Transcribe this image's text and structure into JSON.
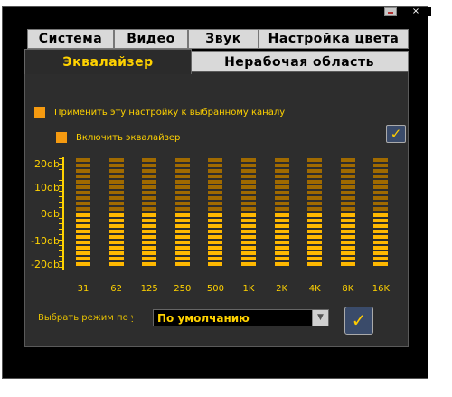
{
  "tabs_row1": [
    {
      "label": "Система"
    },
    {
      "label": "Видео"
    },
    {
      "label": "Звук"
    },
    {
      "label": "Настройка цвета"
    }
  ],
  "tabs_row2": [
    {
      "label": "Эквалайзер",
      "active": true
    },
    {
      "label": "Нерабочая область",
      "active": false
    }
  ],
  "options": {
    "apply_to_channel": "Применить эту настройку к выбранному каналу",
    "enable_equalizer": "Включить эквалайзер"
  },
  "db_labels": [
    "20db",
    "10db",
    "0db",
    "-10db",
    "-20db"
  ],
  "bands": [
    {
      "freq": "31",
      "level_db": 0
    },
    {
      "freq": "62",
      "level_db": 0
    },
    {
      "freq": "125",
      "level_db": 0
    },
    {
      "freq": "250",
      "level_db": 0
    },
    {
      "freq": "500",
      "level_db": 0
    },
    {
      "freq": "1K",
      "level_db": 0
    },
    {
      "freq": "2K",
      "level_db": 0
    },
    {
      "freq": "4K",
      "level_db": 0
    },
    {
      "freq": "8K",
      "level_db": 0
    },
    {
      "freq": "16K",
      "level_db": 0
    }
  ],
  "mode": {
    "label": "Выбрать режим по у",
    "selected": "По умолчанию"
  },
  "window": {
    "close_glyph": "×"
  },
  "colors": {
    "accent": "#ffd200",
    "segment_on": "#ffb800",
    "segment_off": "#a06a00",
    "panel": "#2d2d2d"
  }
}
